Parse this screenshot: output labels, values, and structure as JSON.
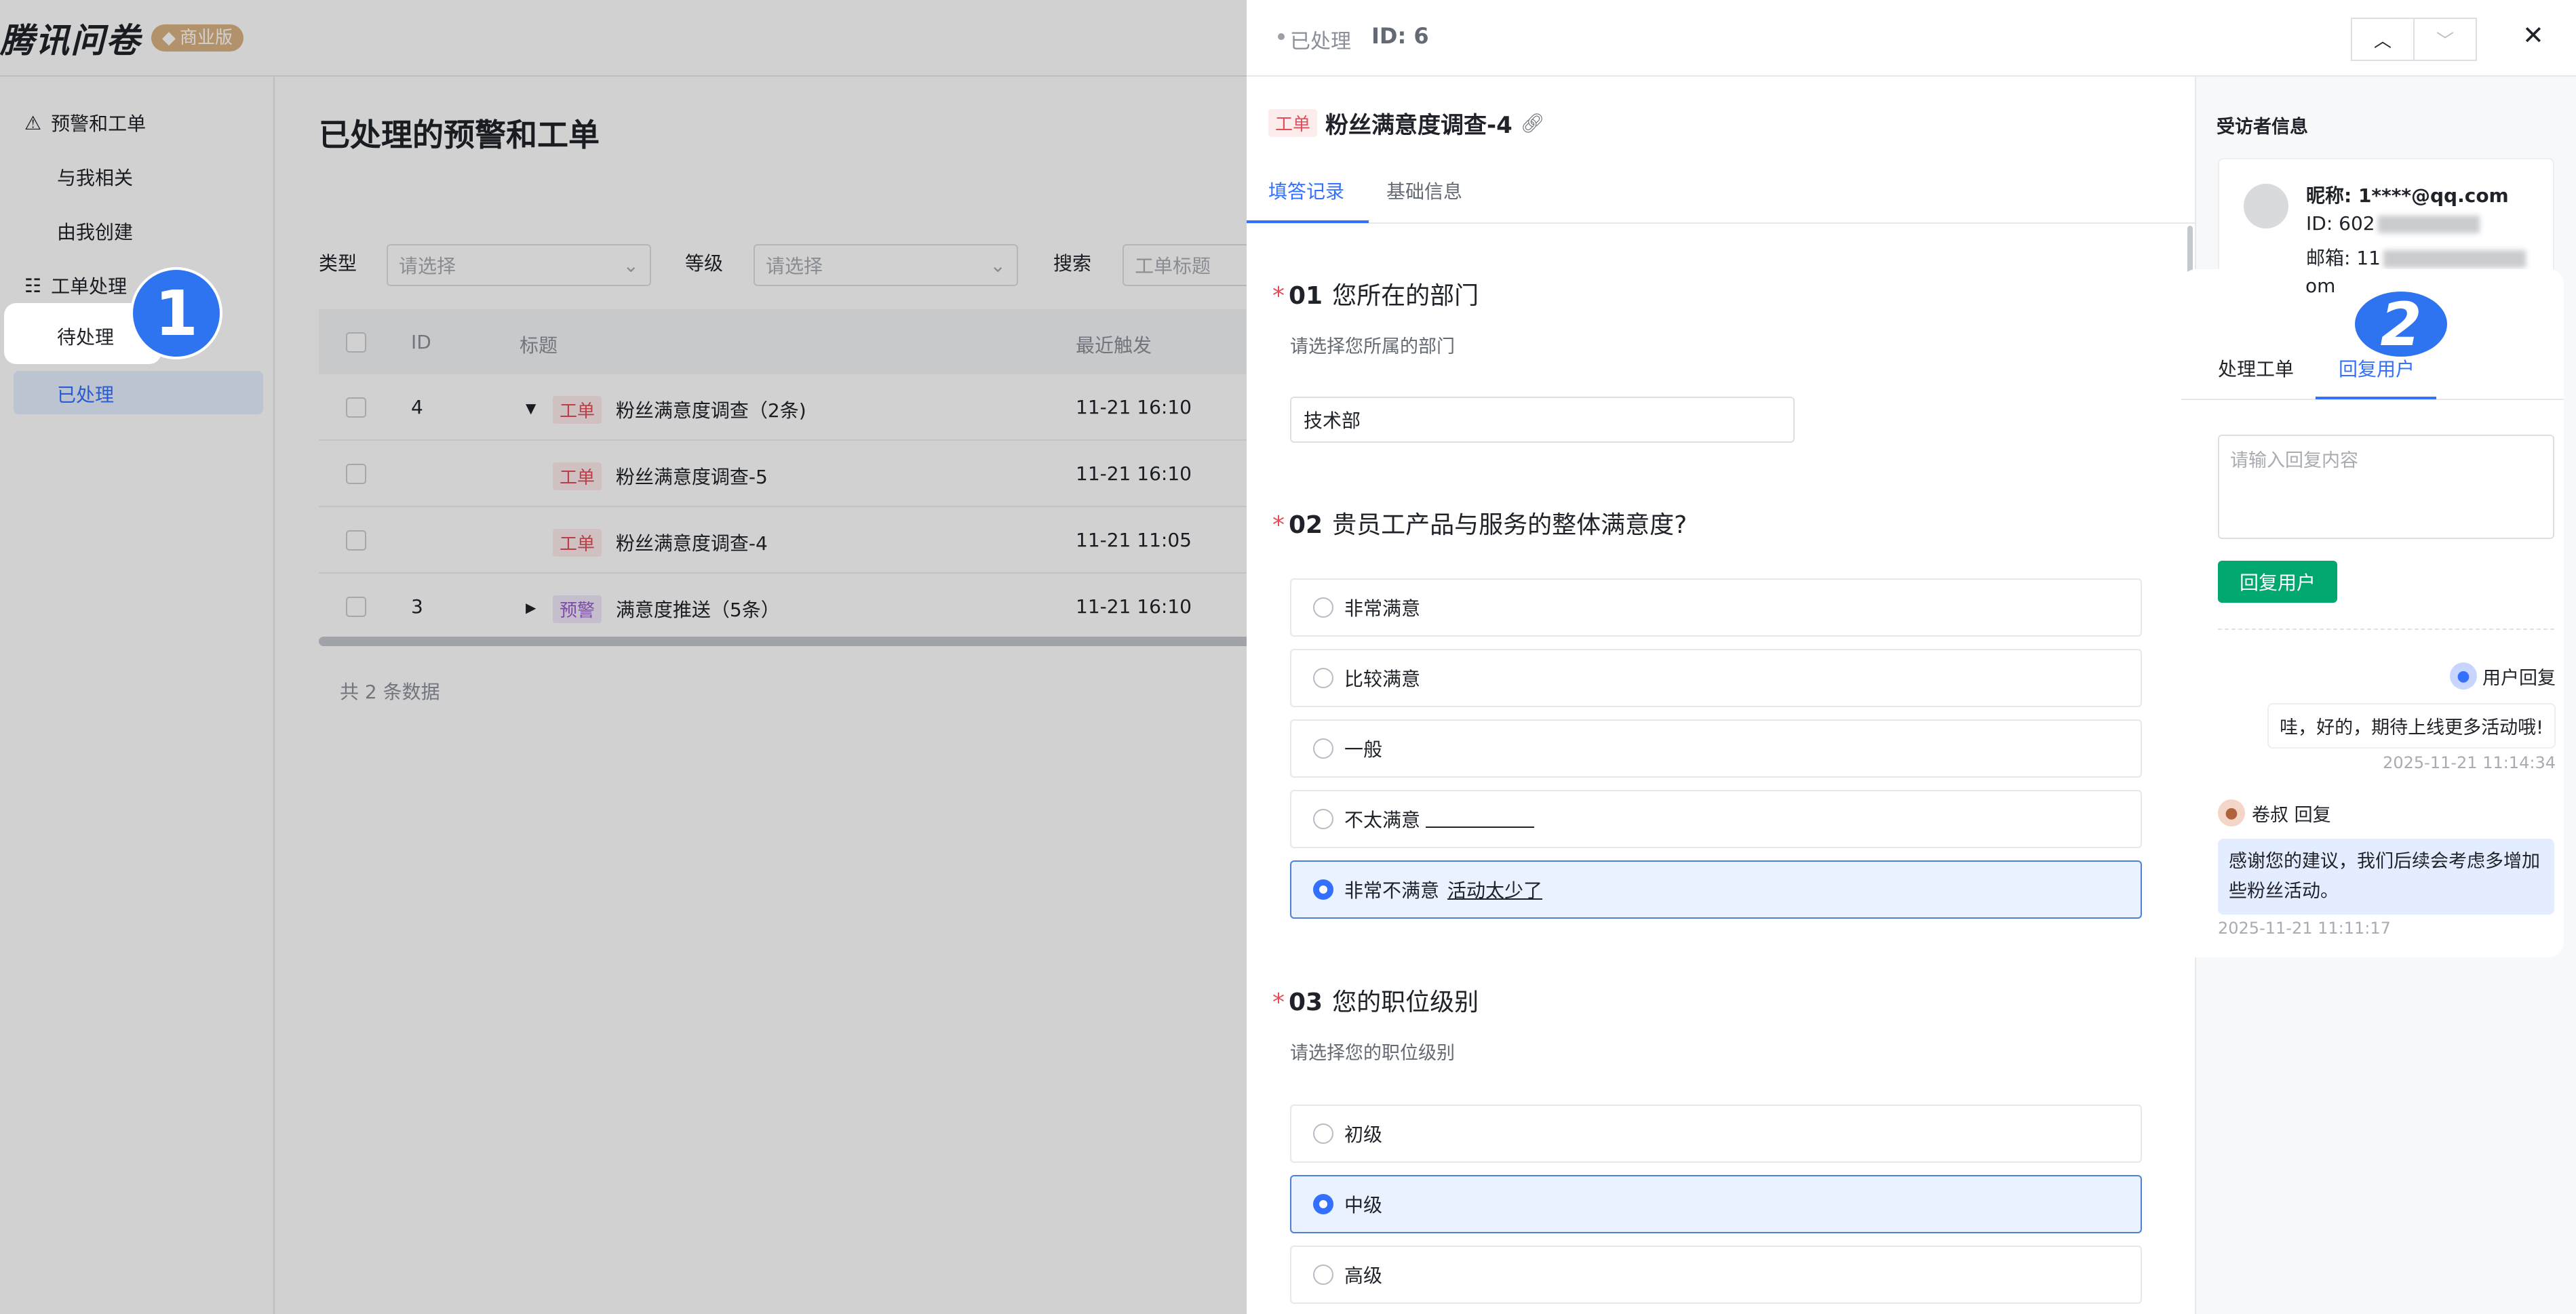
{
  "brand": {
    "name": "腾讯问卷",
    "edition": "商业版",
    "edition_icon": "diamond-icon"
  },
  "sidebar": {
    "group1": "预警和工单",
    "group1_items": [
      "与我相关",
      "由我创建"
    ],
    "group2": "工单处理",
    "group2_items": [
      "待处理",
      "已处理"
    ]
  },
  "main": {
    "title": "已处理的预警和工单",
    "filters": {
      "type_label": "类型",
      "type_placeholder": "请选择",
      "level_label": "等级",
      "level_placeholder": "请选择",
      "search_label": "搜索",
      "search_placeholder": "工单标题"
    },
    "columns": [
      "ID",
      "标题",
      "最近触发"
    ],
    "rows": [
      {
        "id": "4",
        "tag": "工单",
        "title": "粉丝满意度调查（2条)",
        "time": "11-21 16:10"
      },
      {
        "id": "",
        "tag": "工单",
        "title": "粉丝满意度调查-5",
        "time": "11-21 16:10"
      },
      {
        "id": "",
        "tag": "工单",
        "title": "粉丝满意度调查-4",
        "time": "11-21 11:05"
      },
      {
        "id": "3",
        "tag": "预警",
        "title": "满意度推送（5条）",
        "time": "11-21 16:10"
      }
    ],
    "total": "共 2 条数据"
  },
  "drawer": {
    "status": "已处理",
    "id_text": "ID: 6",
    "tag": "工单",
    "title": "粉丝满意度调查-4",
    "tabs": [
      "填答记录",
      "基础信息"
    ],
    "q1": {
      "num": "01",
      "text": "您所在的部门",
      "hint": "请选择您所属的部门",
      "answer": "技术部"
    },
    "q2": {
      "num": "02",
      "text": "贵员工产品与服务的整体满意度?",
      "options": [
        "非常满意",
        "比较满意",
        "一般",
        "不太满意",
        "非常不满意"
      ],
      "selected_extra": "活动太少了"
    },
    "q3": {
      "num": "03",
      "text": "您的职位级别",
      "hint": "请选择您的职位级别",
      "options": [
        "初级",
        "中级",
        "高级"
      ]
    }
  },
  "respondent": {
    "heading": "受访者信息",
    "nickname": "昵称: 1****@qq.com",
    "id_prefix": "ID: 602",
    "email_prefix": "邮箱: 11",
    "email_suffix": "om"
  },
  "reply": {
    "tabs": [
      "处理工单",
      "回复用户"
    ],
    "placeholder": "请输入回复内容",
    "button": "回复用户",
    "user_label": "用户回复",
    "user_message": "哇，好的，期待上线更多活动哦!",
    "user_time": "2025-11-21 11:14:34",
    "staff_label": "卷叔 回复",
    "staff_message": "感谢您的建议，我们后续会考虑多增加些粉丝活动。",
    "staff_time": "2025-11-21 11:11:17"
  },
  "steps": [
    "1",
    "2"
  ],
  "colors": {
    "accent": "#3370ff",
    "reply_button": "#00a870",
    "step_badge": "#2e74f0"
  }
}
